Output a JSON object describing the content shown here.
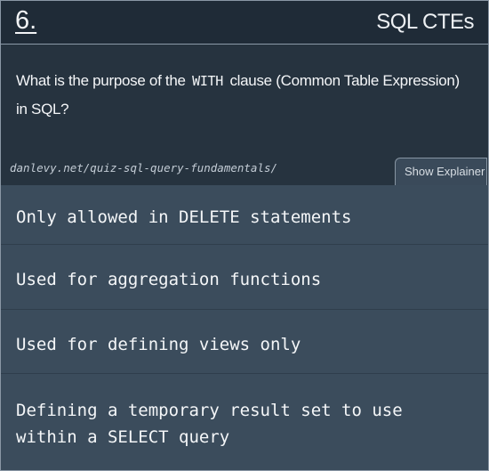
{
  "header": {
    "question_number": "6.",
    "topic": "SQL CTEs"
  },
  "question": {
    "text_before": "What is the purpose of the",
    "code": "WITH",
    "text_after": "clause (Common Table Expression) in SQL?",
    "source": "danlevy.net/quiz-sql-query-fundamentals/",
    "explainer_label": "Show Explainer"
  },
  "answers": [
    "Only allowed in DELETE statements",
    "Used for aggregation functions",
    "Used for defining views only",
    "Defining a temporary result set to use within a SELECT query"
  ]
}
